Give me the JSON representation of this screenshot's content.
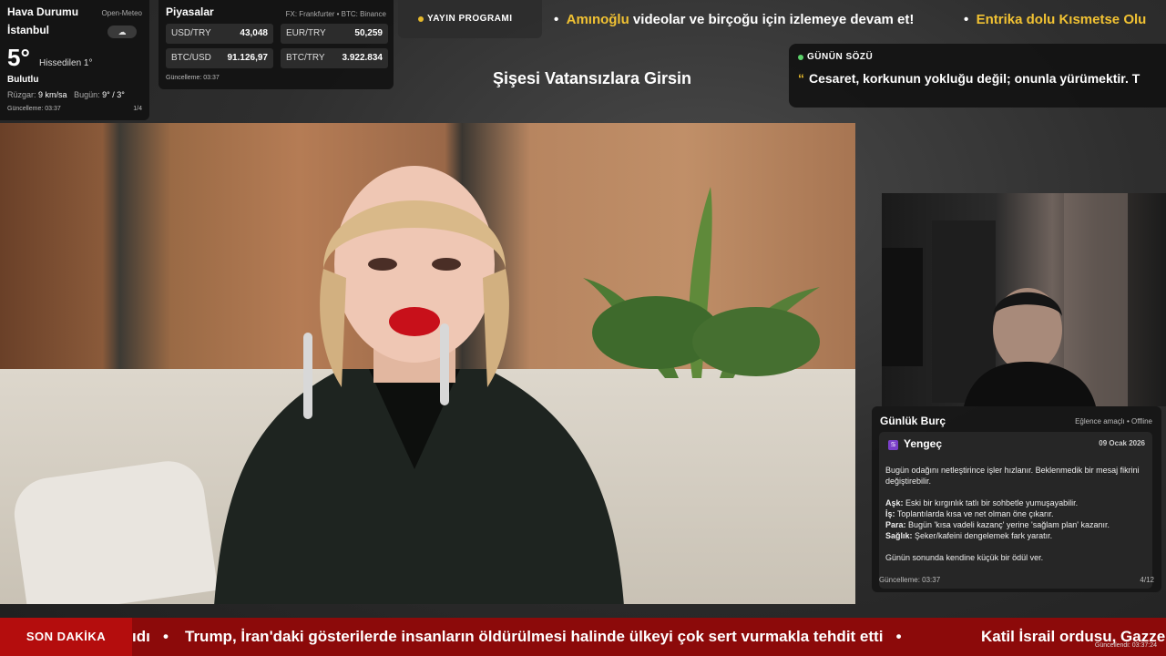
{
  "weather": {
    "title": "Hava Durumu",
    "source": "Open-Meteo",
    "city": "İstanbul",
    "cloud_icon": "☁",
    "temp": "5°",
    "feels": "Hissedilen 1°",
    "condition": "Bulutlu",
    "wind_label": "Rüzgar:",
    "wind_value": "9 km/sa",
    "today_label": "Bugün:",
    "today_value": "9° / 3°",
    "updated": "Güncelleme: 03:37",
    "page": "1/4"
  },
  "markets": {
    "title": "Piyasalar",
    "source": "FX: Frankfurter • BTC: Binance",
    "items": [
      {
        "label": "USD/TRY",
        "value": "43,048"
      },
      {
        "label": "EUR/TRY",
        "value": "50,259"
      },
      {
        "label": "BTC/USD",
        "value": "91.126,97"
      },
      {
        "label": "BTC/TRY",
        "value": "3.922.834"
      }
    ],
    "updated": "Güncelleme: 03:37"
  },
  "program": {
    "label": "YAYIN PROGRAMI"
  },
  "ticker_top": {
    "seg1_hl": "Amınoğlu",
    "seg1_rest": " videolar ve birçoğu için izlemeye devam et!",
    "seg2_hl": "Entrika dolu Kısmetse Olu"
  },
  "show_title": "Şişesi Vatansızlara Girsin",
  "quote": {
    "label": "GÜNÜN SÖZÜ",
    "mark": "“",
    "text": "Cesaret, korkunun yokluğu değil; onunla yürümektir. T"
  },
  "horoscope": {
    "title": "Günlük Burç",
    "mode": "Eğlence amaçlı • Offline",
    "sign_symbol": "♋",
    "sign": "Yengeç",
    "date": "09 Ocak 2026",
    "intro": "Bugün odağını netleştirince işler hızlanır. Beklenmedik bir mesaj fikrini değiştirebilir.",
    "love_label": "Aşk:",
    "love": " Eski bir kırgınlık tatlı bir sohbetle yumuşayabilir.",
    "work_label": "İş:",
    "work": " Toplantılarda kısa ve net olman öne çıkarır.",
    "money_label": "Para:",
    "money": " Bugün 'kısa vadeli kazanç' yerine 'sağlam plan' kazanır.",
    "health_label": "Sağlık:",
    "health": " Şeker/kafeini dengelemek fark yaratır.",
    "closing": "Günün sonunda kendine küçük bir ödül ver.",
    "updated": "Güncelleme: 03:37",
    "page": "4/12"
  },
  "breaking": {
    "label": "SON DAKİKA",
    "seg0": "ıdı",
    "seg1": "Trump, İran'daki gösterilerde insanların öldürülmesi halinde ülkeyi çok sert vurmakla tehdit etti",
    "seg2": "Katil İsrail ordusu, Gazze",
    "updated": "Güncellendi: 03:37:24"
  },
  "colors": {
    "accent": "#f1c233",
    "breaking_bg": "#8c0a0a",
    "breaking_label": "#b40d0d",
    "live_dot": "#5bd36a"
  }
}
